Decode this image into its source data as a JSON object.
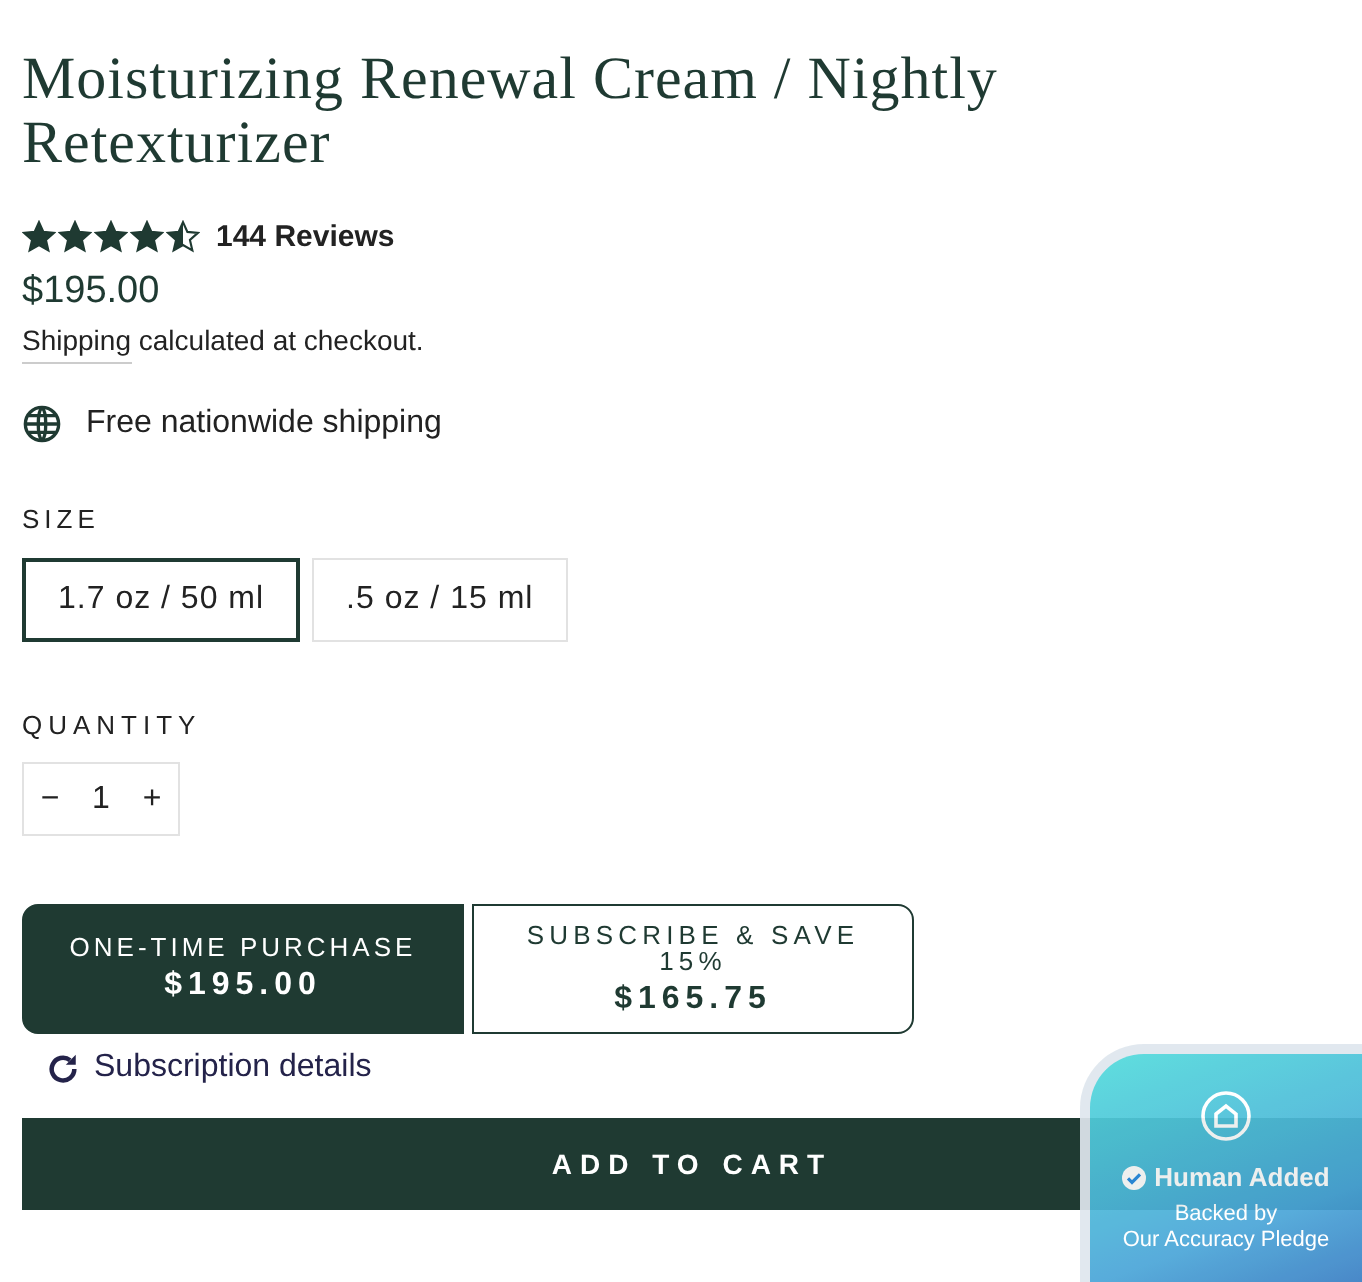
{
  "product": {
    "title": "Moisturizing Renewal Cream / Nightly Retexturizer",
    "rating": {
      "stars": 4.5,
      "reviews": "144 Reviews"
    },
    "price": "$195.00",
    "shipping_note": {
      "link": "Shipping",
      "text": "calculated at checkout."
    },
    "perk": "Free nationwide shipping"
  },
  "size": {
    "label": "SIZE",
    "options": [
      {
        "label": "1.7 oz / 50 ml",
        "selected": true
      },
      {
        "label": ".5 oz / 15 ml",
        "selected": false
      }
    ]
  },
  "quantity": {
    "label": "QUANTITY",
    "decrement": "−",
    "value": "1",
    "increment": "+"
  },
  "purchase_options": [
    {
      "label": "ONE-TIME PURCHASE",
      "price": "$195.00",
      "selected": true
    },
    {
      "label": "SUBSCRIBE & SAVE 15%",
      "price": "$165.75",
      "selected": false
    }
  ],
  "subscription_link": "Subscription details",
  "add_to_cart": "ADD TO CART",
  "badge": {
    "title": "Human Added",
    "subtitle_lines": [
      "Backed by",
      "Our Accuracy Pledge"
    ]
  }
}
